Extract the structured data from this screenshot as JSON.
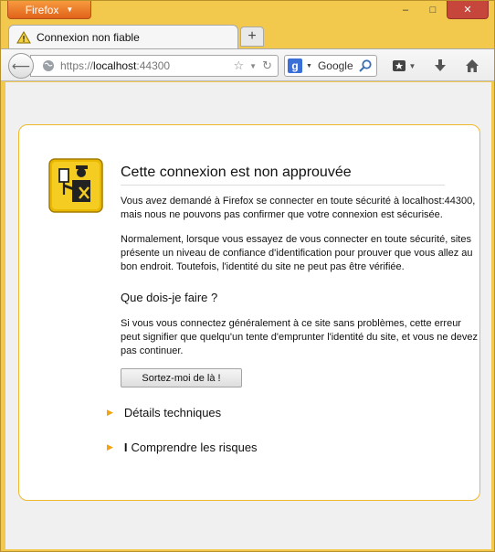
{
  "window": {
    "app_button": "Firefox",
    "minimize": "–",
    "maximize": "□",
    "close": "✕"
  },
  "tab": {
    "title": "Connexion non fiable",
    "new_tab": "+"
  },
  "navbar": {
    "url_scheme": "https://",
    "url_host": "localhost",
    "url_port": ":44300",
    "search_engine": "Google"
  },
  "error": {
    "title": "Cette connexion est non approuvée",
    "p1": "Vous avez demandé à Firefox se connecter en toute sécurité à localhost:44300, mais nous ne pouvons pas confirmer que votre connexion est sécurisée.",
    "p2": "Normalement, lorsque vous essayez de vous connecter en toute sécurité, sites présente un niveau de confiance d'identification pour prouver que vous allez au bon endroit. Toutefois, l'identité du site ne peut pas être vérifiée.",
    "what_to_do": "Que dois-je faire ?",
    "p3": "Si vous vous connectez généralement à ce site sans problèmes, cette erreur peut signifier que quelqu'un tente d'emprunter l'identité du site, et vous ne devez pas continuer.",
    "get_out_button": "Sortez-moi de là !",
    "technical_details": "Détails techniques",
    "understand_risks": "Comprendre les risques"
  },
  "colors": {
    "frame": "#f2c94c",
    "accent_orange": "#e0631a",
    "box_border": "#f0b92b"
  }
}
